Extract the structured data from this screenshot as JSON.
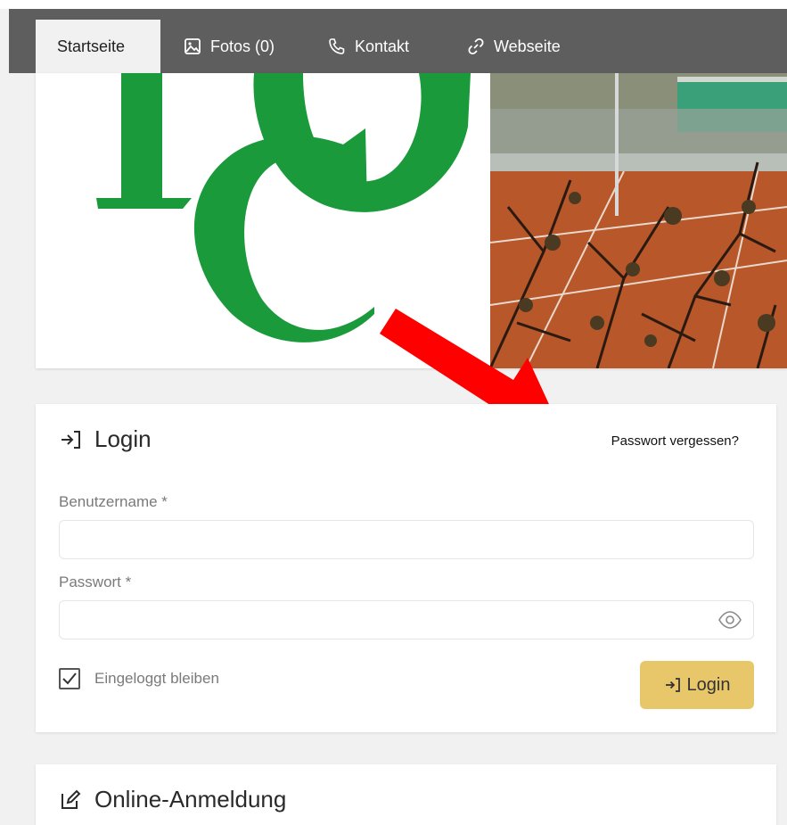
{
  "nav": {
    "tabs": [
      {
        "label": "Startseite",
        "icon": ""
      },
      {
        "label": "Fotos (0)",
        "icon": "image-icon"
      },
      {
        "label": "Kontakt",
        "icon": "phone-icon"
      },
      {
        "label": "Webseite",
        "icon": "link-icon"
      }
    ],
    "active_tab": "Startseite"
  },
  "banner": {
    "logo_icon": "club-logo-icon",
    "photo_icon": "tennis-court-photo"
  },
  "login": {
    "title": "Login",
    "forgot_link": "Passwort vergessen?",
    "username_label": "Benutzername *",
    "username_value": "",
    "password_label": "Passwort *",
    "password_value": "",
    "remember_label": "Eingeloggt bleiben",
    "remember_checked": true,
    "button_label": "Login"
  },
  "registration": {
    "title": "Online-Anmeldung"
  },
  "colors": {
    "nav_bg": "#5e5e5e",
    "page_bg": "#f1f1f1",
    "logo_green": "#1a9a3a",
    "button_yellow": "#e8c76a",
    "arrow_red": "#ff0000"
  }
}
